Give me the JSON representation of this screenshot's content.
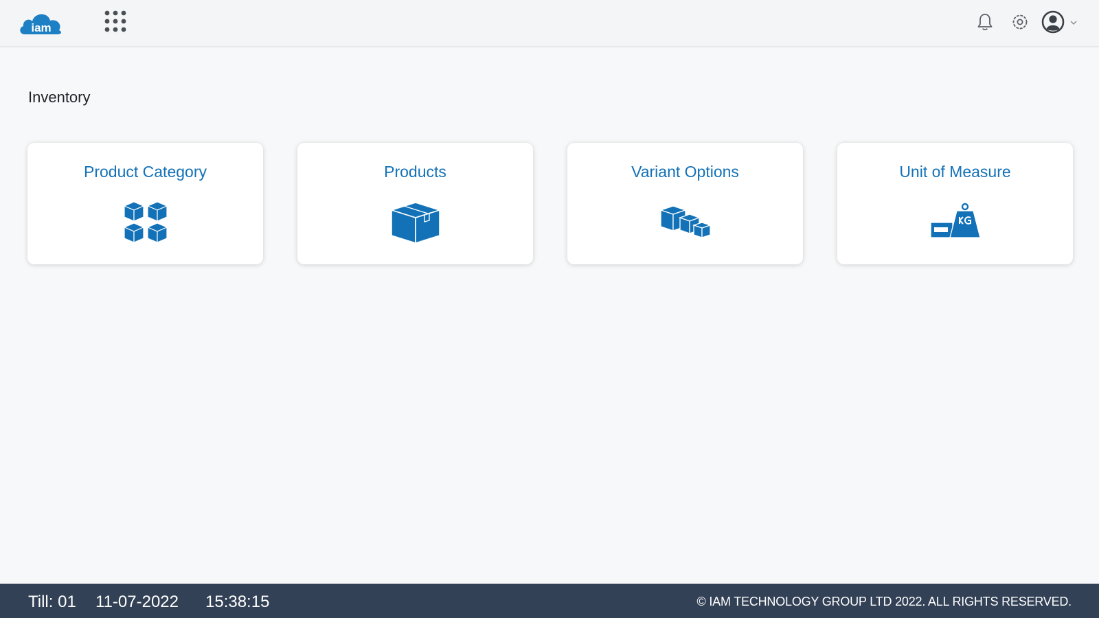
{
  "header": {
    "logo_text": "iam",
    "logo_icon": "cloud-logo",
    "apps_icon": "apps-grid-icon",
    "notification_icon": "bell-icon",
    "settings_icon": "gear-icon",
    "profile_icon": "user-circle-icon"
  },
  "page": {
    "title": "Inventory"
  },
  "cards": [
    {
      "label": "Product Category",
      "icon": "boxes-grid-icon"
    },
    {
      "label": "Products",
      "icon": "box-icon"
    },
    {
      "label": "Variant Options",
      "icon": "boxes-stack-icon"
    },
    {
      "label": "Unit of Measure",
      "icon": "weight-kg-icon"
    }
  ],
  "footer": {
    "till": "Till: 01",
    "date": "11-07-2022",
    "time": "15:38:15",
    "copyright": "© IAM TECHNOLOGY GROUP LTD 2022. ALL RIGHTS RESERVED."
  },
  "colors": {
    "accent": "#1372b7",
    "footer_bg": "#334156",
    "page_bg": "#f7f8f9"
  }
}
